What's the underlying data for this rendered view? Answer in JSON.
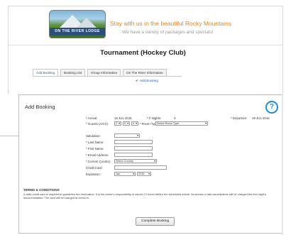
{
  "header": {
    "logo_text": "ON THE RIVER LODGE",
    "tagline": "Stay with us in the beautiful Rocky Mountains",
    "subtagline": "We have a variety of packages and specials!",
    "page_title": "Tournament (Hockey Club)"
  },
  "tabs": [
    {
      "label": "Add Booking",
      "active": true
    },
    {
      "label": "Booking List",
      "active": false
    },
    {
      "label": "Group Information",
      "active": false
    },
    {
      "label": "On The River Information",
      "active": false
    }
  ],
  "sub_action": {
    "check": "✔",
    "label": "Add Booking"
  },
  "panel": {
    "title": "Add Booking",
    "help": "?",
    "arrival_label": "* Arrival:",
    "arrival_value": "16 JUL 2016",
    "nights_label": "* # Nights:",
    "nights_value": "3",
    "departure_label": "* Departure:",
    "departure_value": "19 JUL 2016",
    "guests_label": "* Guests (A/C/I):",
    "guests_a": "2",
    "guests_c": "0",
    "guests_i": "0",
    "room_type_label": "* Room Type:",
    "room_type_value": "Select Room Type",
    "salutation_label": "Salutation:",
    "last_name_label": "* Last Name:",
    "first_name_label": "* First Name:",
    "email_label": "* Email Address:",
    "country_label": "* Current Country:",
    "country_value": "Select Country",
    "card_label": "Credit Card:",
    "expiration_label": "Expiration:",
    "exp_month": "Jan",
    "exp_year": "2016",
    "terms_title": "TERMS & CONDITIONS",
    "terms_text": "A valid credit card is required to guarantee the reservation. It is the renter's responsibility to cancel 72 hours before the scheduled arrival. No-shows or late cancellations will be charged the first night's accommodation. The card will be charged at check-in.",
    "complete_button": "Complete Booking"
  }
}
